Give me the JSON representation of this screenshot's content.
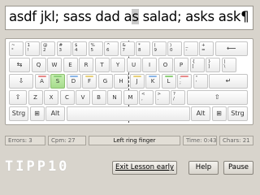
{
  "text_line": {
    "before": "asdf jkl; sass dad a",
    "current": "s",
    "after": " salad; asks ask¶"
  },
  "keyboard": {
    "row1": [
      "~\n°",
      "1\n!",
      "@\n2",
      "#\n3",
      "$\n4",
      "%\n5",
      "^\n6",
      "&\n7",
      "*\n8",
      "(\n9",
      ")\n0",
      "_\n-",
      "+\n="
    ],
    "backspace": "⟵",
    "tab": "⇆",
    "row2": [
      "Q",
      "W",
      "E",
      "R",
      "T",
      "Y",
      "U",
      "I",
      "O",
      "P",
      "{\n[",
      "}\n]",
      "|\n\\"
    ],
    "capslock": "⇩",
    "row3": [
      "A",
      "S",
      "D",
      "F",
      "G",
      "H",
      "J",
      "K",
      "L",
      ":\n;",
      "\"\n'"
    ],
    "enter": "↵",
    "shift_left": "⇧",
    "row4": [
      "Z",
      "X",
      "C",
      "V",
      "B",
      "N",
      "M",
      "<\n,",
      ">\n.",
      "?\n/"
    ],
    "shift_right": "⇧",
    "ctrl_left": "Strg",
    "win_left": "⊞",
    "alt": "Alt",
    "altgr": "Alt",
    "win_right": "⊞",
    "ctrl_right": "Strg",
    "active_key": "S",
    "finger_colors": {
      "pinky": "#e88a8a",
      "ring": "#8ed07a",
      "middle": "#8ab6e8",
      "index": "#e8d07a"
    }
  },
  "status": {
    "errors": "Errors: 3",
    "cpm": "Cpm: 27",
    "finger": "Left ring finger",
    "time": "Time: 0:43",
    "chars": "Chars: 21"
  },
  "logo": "TIPP10",
  "buttons": {
    "exit": "Exit Lesson early",
    "help": "Help",
    "pause": "Pause"
  }
}
